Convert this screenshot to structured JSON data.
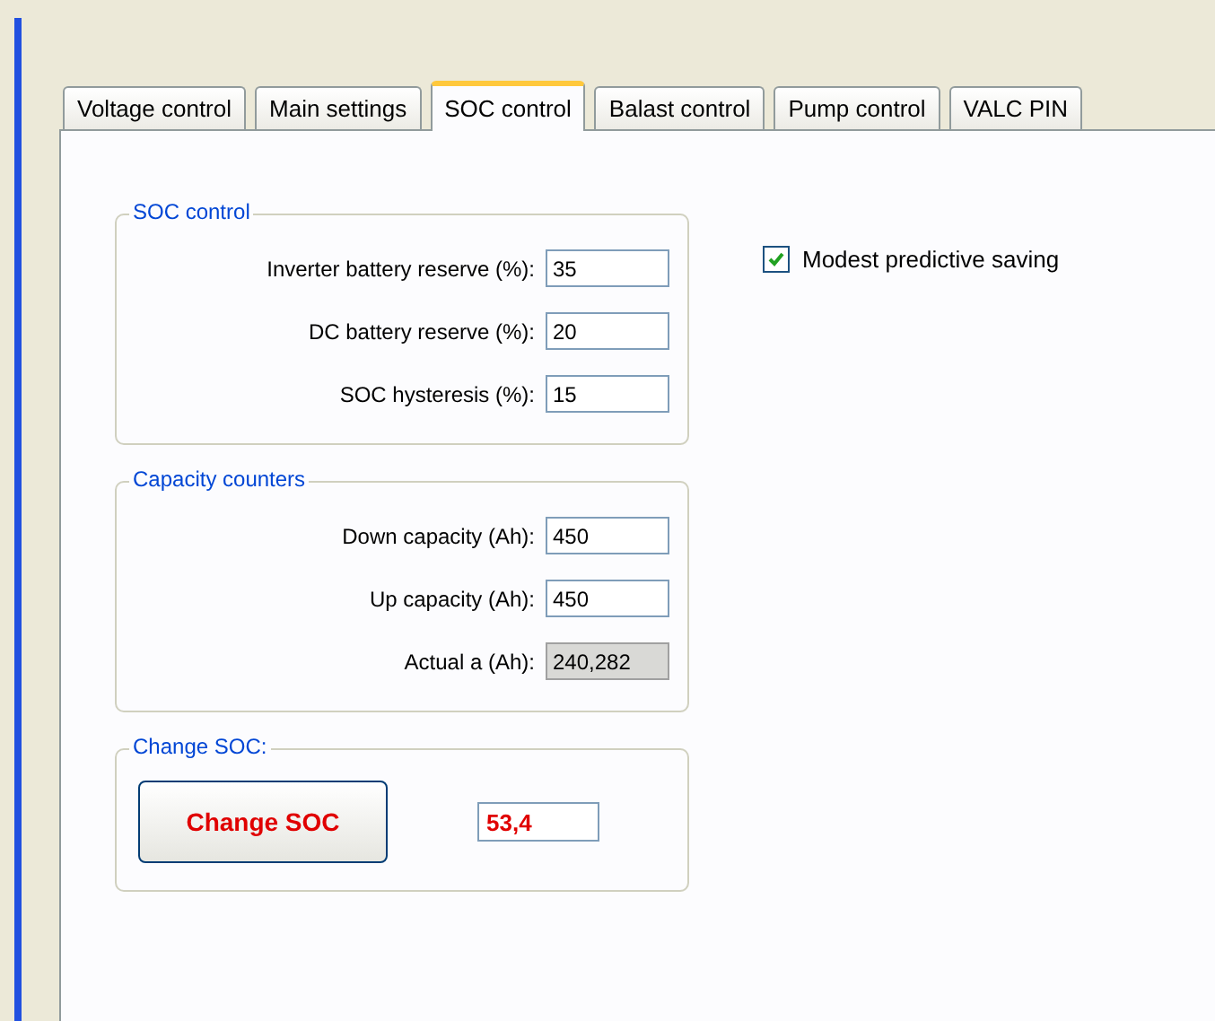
{
  "tabs": [
    {
      "label": "Voltage control",
      "selected": false
    },
    {
      "label": "Main settings",
      "selected": false
    },
    {
      "label": "SOC control",
      "selected": true
    },
    {
      "label": "Balast control",
      "selected": false
    },
    {
      "label": "Pump control",
      "selected": false
    },
    {
      "label": "VALC PIN",
      "selected": false
    }
  ],
  "groups": [
    {
      "title": "SOC control",
      "kind": "fields",
      "fields": [
        {
          "label": "Inverter battery reserve (%):",
          "value": "35",
          "disabled": false
        },
        {
          "label": "DC battery reserve (%):",
          "value": "20",
          "disabled": false
        },
        {
          "label": "SOC hysteresis (%):",
          "value": "15",
          "disabled": false
        }
      ]
    },
    {
      "title": "Capacity counters",
      "kind": "fields",
      "fields": [
        {
          "label": "Down capacity (Ah):",
          "value": "450",
          "disabled": false
        },
        {
          "label": "Up capacity (Ah):",
          "value": "450",
          "disabled": false
        },
        {
          "label": "Actual a (Ah):",
          "value": "240,282",
          "disabled": true
        }
      ]
    },
    {
      "title": "Change SOC:",
      "kind": "action",
      "button": "Change SOC",
      "value": "53,4"
    }
  ],
  "options": [
    {
      "label": "Modest predictive saving",
      "checked": true
    }
  ]
}
